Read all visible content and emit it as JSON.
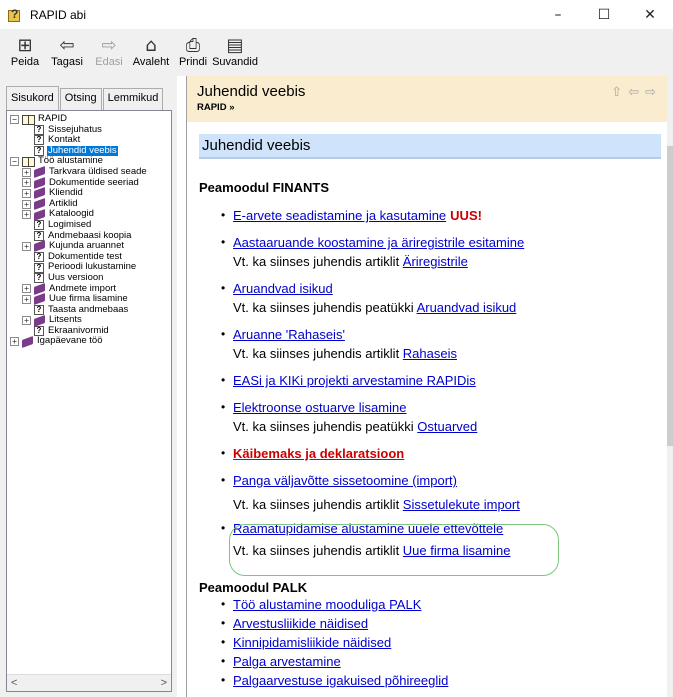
{
  "window": {
    "title": "RAPID abi",
    "controls": {
      "minimize": "–",
      "maximize": "☐",
      "close": "✕"
    }
  },
  "toolbar": {
    "buttons": [
      {
        "label": "Peida",
        "icon": "hide-panel-icon",
        "glyph": "⊞"
      },
      {
        "label": "Tagasi",
        "icon": "back-arrow-icon",
        "glyph": "⇦"
      },
      {
        "label": "Edasi",
        "icon": "forward-arrow-icon",
        "glyph": "⇨"
      },
      {
        "label": "Avaleht",
        "icon": "home-icon",
        "glyph": "⌂"
      },
      {
        "label": "Prindi",
        "icon": "print-icon",
        "glyph": "⎙"
      },
      {
        "label": "Suvandid",
        "icon": "options-icon",
        "glyph": "▤"
      }
    ]
  },
  "left": {
    "tabs": [
      {
        "label": "Sisukord"
      },
      {
        "label": "Otsing"
      },
      {
        "label": "Lemmikud"
      }
    ],
    "tree": [
      "RAPID",
      "Sissejuhatus",
      "Kontakt",
      "Juhendid veebis",
      "Töö alustamine",
      "Tarkvara üldised seade",
      "Dokumentide seeriad",
      "Kliendid",
      "Artiklid",
      "Kataloogid",
      "Logimised",
      "Andmebaasi koopia",
      "Kujunda aruannet",
      "Dokumentide test",
      "Perioodi lukustamine",
      "Uus versioon",
      "Andmete import",
      "Uue firma lisamine",
      "Taasta andmebaas",
      "Litsents",
      "Ekraanivormid",
      "Igapäevane töö"
    ],
    "scroll": {
      "left": "<",
      "right": ">"
    }
  },
  "right": {
    "header": {
      "title": "Juhendid veebis",
      "breadcrumb": "RAPID »"
    },
    "h1": "Juhendid veebis",
    "section1": "Peamoodul FINANTS",
    "uus_label": "UUS!",
    "items1": [
      {
        "text": "E-arvete seadistamine ja kasutamine"
      },
      {
        "text": "Aastaaruande koostamine ja äriregistrile esitamine",
        "sub_prefix": "Vt. ka siinses juhendis artiklit ",
        "sub_link": "Äriregistrile"
      },
      {
        "text": "Aruandvad isikud",
        "sub_prefix": "Vt. ka siinses juhendis peatükki ",
        "sub_link": "Aruandvad isikud"
      },
      {
        "text": "Aruanne 'Rahaseis'",
        "sub_prefix": "Vt. ka siinses juhendis artiklit ",
        "sub_link": "Rahaseis"
      },
      {
        "text": "EASi ja KIKi projekti arvestamine RAPIDis"
      },
      {
        "text": "Elektroonse ostuarve lisamine",
        "sub_prefix": "Vt. ka siinses juhendis peatükki ",
        "sub_link": "Ostuarved"
      },
      {
        "text": "Käibemaks ja deklaratsioon"
      },
      {
        "text": "Panga väljavõtte sissetoomine (import)",
        "sub_prefix": "Vt. ka siinses juhendis artiklit ",
        "sub_link": "Sissetulekute import"
      },
      {
        "text": "Raamatupidamise alustamine uuele ettevõttele",
        "sub_prefix": "Vt. ka siinses juhendis artiklit ",
        "sub_link": "Uue firma lisamine"
      }
    ],
    "section2": "Peamoodul PALK",
    "items2": [
      {
        "text": "Töö alustamine mooduliga PALK"
      },
      {
        "text": "Arvestusliikide näidised"
      },
      {
        "text": "Kinnipidamisliikide näidised"
      },
      {
        "text": "Palga arvestamine"
      },
      {
        "text": "Palgaarvestuse igakuised põhireeglid"
      }
    ]
  }
}
